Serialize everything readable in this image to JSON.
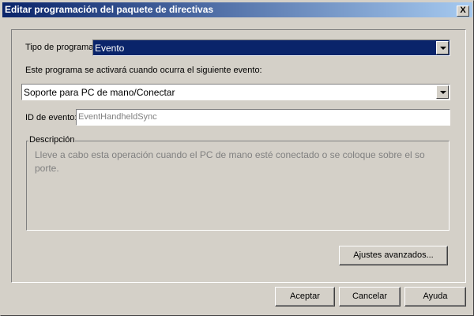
{
  "window": {
    "title": "Editar programación del paquete de directivas",
    "close_label": "X"
  },
  "schedule_type": {
    "label": "Tipo de programa:",
    "value": "Evento"
  },
  "event_prompt": "Este programa se activará cuando ocurra el siguiente evento:",
  "event_select": {
    "value": "Soporte para PC de mano/Conectar"
  },
  "event_id": {
    "label": "ID de evento:",
    "value": "EventHandheldSync"
  },
  "description": {
    "label": "Descripción",
    "text": "Lleve a cabo esta operación cuando el PC de mano esté conectado o se coloque sobre el so porte."
  },
  "buttons": {
    "advanced": "Ajustes avanzados...",
    "ok": "Aceptar",
    "cancel": "Cancelar",
    "help": "Ayuda"
  }
}
